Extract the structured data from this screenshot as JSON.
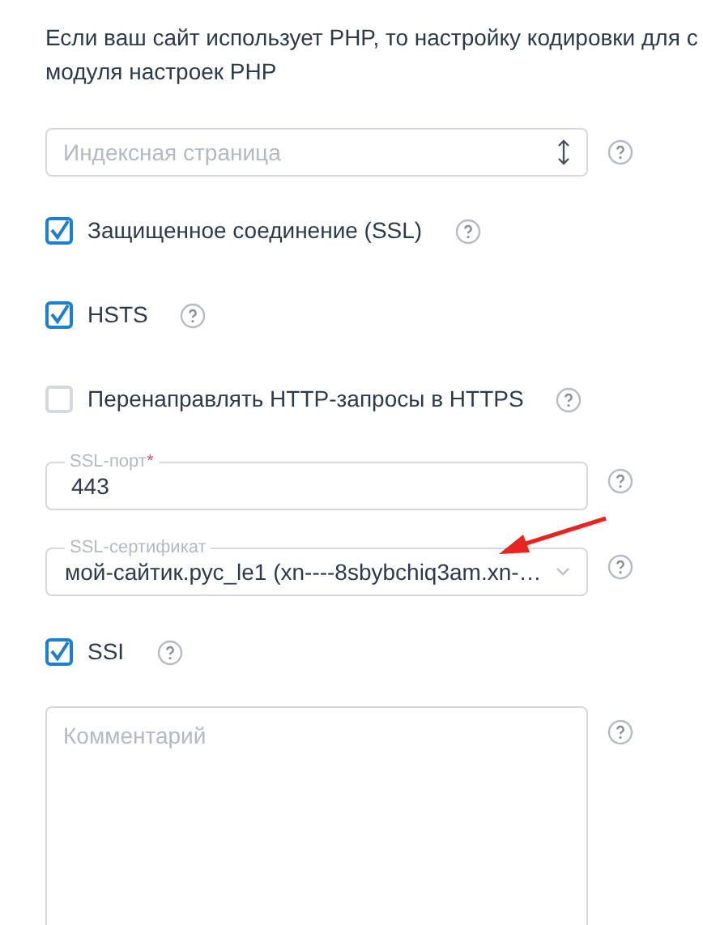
{
  "intro": {
    "lines": [
      "Если ваш сайт использует PHP, то настройку кодировки для с",
      "модуля настроек PHP"
    ]
  },
  "fields": [
    {
      "kind": "select",
      "placeholder": "Индексная страница"
    },
    {
      "kind": "checkbox",
      "label": "Защищенное соединение (SSL)",
      "checked": true
    },
    {
      "kind": "checkbox",
      "label": "HSTS",
      "checked": true
    },
    {
      "kind": "checkbox",
      "label": "Перенаправлять HTTP-запросы в HTTPS",
      "checked": false
    },
    {
      "kind": "input",
      "label": "SSL-порт",
      "required_mark": "*",
      "value": "443"
    },
    {
      "kind": "dropdown",
      "label": "SSL-сертификат",
      "value": "мой-сайтик.рус_le1 (xn----8sbybchiq3am.xn-…"
    },
    {
      "kind": "checkbox",
      "label": "SSI",
      "checked": true
    },
    {
      "kind": "textarea",
      "placeholder": "Комментарий"
    }
  ]
}
